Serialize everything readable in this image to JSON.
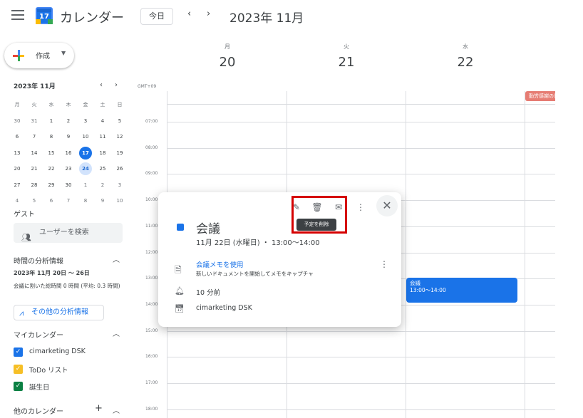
{
  "header": {
    "app_title": "カレンダー",
    "logo_day": "17",
    "today_label": "今日",
    "prev": "‹",
    "next": "›",
    "month_title": "2023年 11月"
  },
  "sidebar": {
    "create_label": "作成",
    "mini_calendar": {
      "title": "2023年 11月",
      "weekdays": [
        "月",
        "火",
        "水",
        "木",
        "金",
        "土",
        "日"
      ],
      "weeks": [
        [
          "30",
          "31",
          "1",
          "2",
          "3",
          "4",
          "5"
        ],
        [
          "6",
          "7",
          "8",
          "9",
          "10",
          "11",
          "12"
        ],
        [
          "13",
          "14",
          "15",
          "16",
          "17",
          "18",
          "19"
        ],
        [
          "20",
          "21",
          "22",
          "23",
          "24",
          "25",
          "26"
        ],
        [
          "27",
          "28",
          "29",
          "30",
          "1",
          "2",
          "3"
        ],
        [
          "4",
          "5",
          "6",
          "7",
          "8",
          "9",
          "10"
        ]
      ]
    },
    "guest_title": "ゲスト",
    "user_search_placeholder": "ユーザーを検索",
    "insights": {
      "title": "時間の分析情報",
      "range": "2023年 11月 20日 ～ 26日",
      "desc": "会議に割いた総時間 0 時間 (平均: 0.3 時間)",
      "more_button": "その他の分析情報"
    },
    "my_calendars": {
      "title": "マイカレンダー",
      "items": [
        {
          "label": "cimarketing DSK",
          "color": "#1a73e8"
        },
        {
          "label": "ToDo リスト",
          "color": "#f6bf26"
        },
        {
          "label": "誕生日",
          "color": "#0b8043"
        }
      ]
    },
    "other_calendars_title": "他のカレンダー"
  },
  "grid": {
    "timezone": "GMT+09",
    "days": [
      {
        "dow": "月",
        "num": "20"
      },
      {
        "dow": "火",
        "num": "21"
      },
      {
        "dow": "水",
        "num": "22"
      }
    ],
    "times": [
      "07:00",
      "08:00",
      "09:00",
      "10:00",
      "11:00",
      "12:00",
      "13:00",
      "14:00",
      "15:00",
      "16:00",
      "17:00",
      "18:00"
    ],
    "holiday_chip": "勤労感謝の日",
    "event_block": {
      "title": "会議",
      "time": "13:00～14:00"
    }
  },
  "popup": {
    "tooltip": "予定を削除",
    "title": "会議",
    "datetime": "11月 22日 (水曜日) ・ 13:00～14:00",
    "notes_link": "会議メモを使用",
    "notes_desc": "新しいドキュメントを開始してメモをキャプチャ",
    "reminder": "10 分前",
    "calendar": "cimarketing DSK",
    "accent_color": "#1a73e8",
    "highlight_color": "#d50000"
  }
}
